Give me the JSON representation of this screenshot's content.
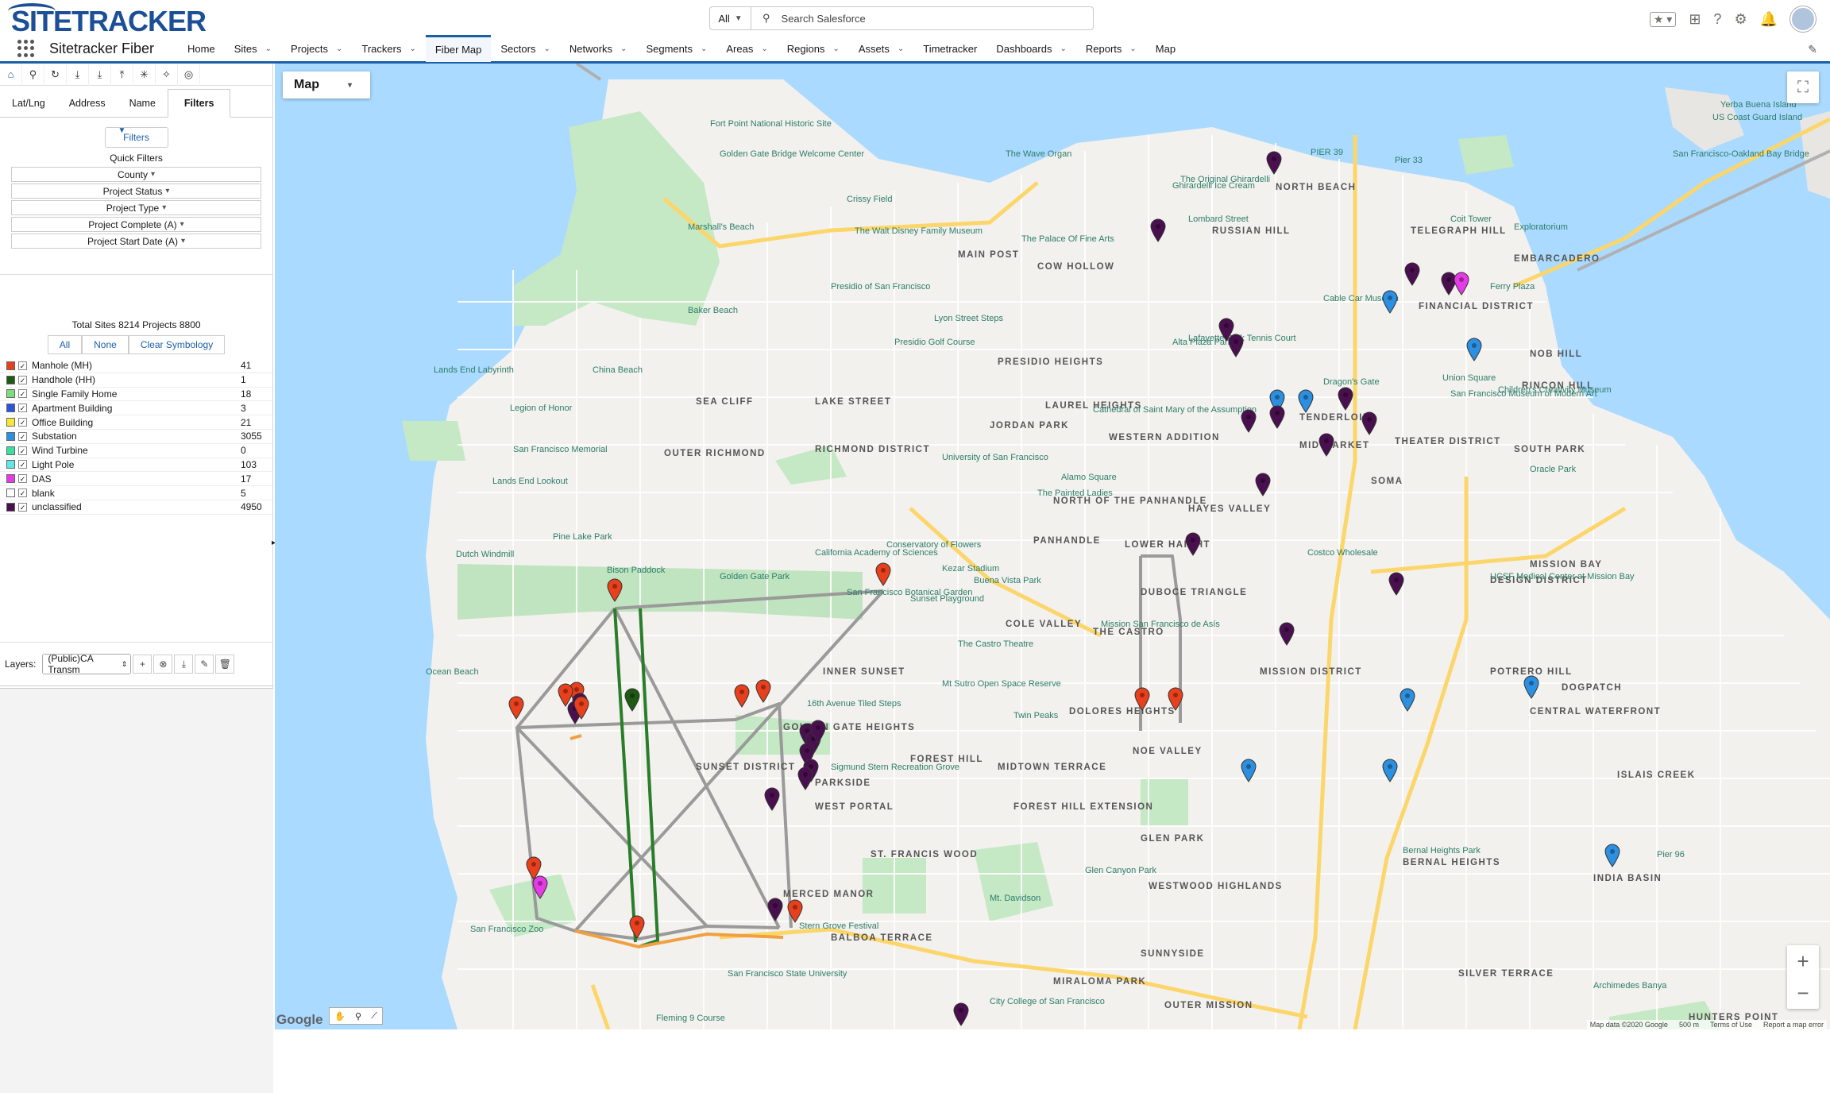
{
  "header": {
    "logo": "SITETRACKER",
    "search_scope": "All",
    "search_placeholder": "Search Salesforce"
  },
  "nav": {
    "app_name": "Sitetracker Fiber",
    "items": [
      {
        "label": "Home",
        "dropdown": false
      },
      {
        "label": "Sites",
        "dropdown": true
      },
      {
        "label": "Projects",
        "dropdown": true
      },
      {
        "label": "Trackers",
        "dropdown": true
      },
      {
        "label": "Fiber Map",
        "dropdown": false,
        "active": true
      },
      {
        "label": "Sectors",
        "dropdown": true
      },
      {
        "label": "Networks",
        "dropdown": true
      },
      {
        "label": "Segments",
        "dropdown": true
      },
      {
        "label": "Areas",
        "dropdown": true
      },
      {
        "label": "Regions",
        "dropdown": true
      },
      {
        "label": "Assets",
        "dropdown": true
      },
      {
        "label": "Timetracker",
        "dropdown": false
      },
      {
        "label": "Dashboards",
        "dropdown": true
      },
      {
        "label": "Reports",
        "dropdown": true
      },
      {
        "label": "Map",
        "dropdown": false
      }
    ]
  },
  "panel": {
    "tabs": [
      "Lat/Lng",
      "Address",
      "Name",
      "Filters"
    ],
    "active_tab": "Filters",
    "filters_button": "Filters",
    "quick_filters_label": "Quick Filters",
    "quick_filters": [
      "County",
      "Project Status",
      "Project Type",
      "Project Complete (A)",
      "Project Start Date (A)"
    ],
    "totals": "Total Sites 8214 Projects 8800",
    "symbology_buttons": [
      "All",
      "None",
      "Clear Symbology"
    ],
    "legend": [
      {
        "name": "Manhole (MH)",
        "count": "41",
        "color": "#e8401c"
      },
      {
        "name": "Handhole (HH)",
        "count": "1",
        "color": "#1e5a14"
      },
      {
        "name": "Single Family Home",
        "count": "18",
        "color": "#7be07b"
      },
      {
        "name": "Apartment Building",
        "count": "3",
        "color": "#2a55d8"
      },
      {
        "name": "Office Building",
        "count": "21",
        "color": "#f7e836"
      },
      {
        "name": "Substation",
        "count": "3055",
        "color": "#2c8fe0"
      },
      {
        "name": "Wind Turbine",
        "count": "0",
        "color": "#3be0a0"
      },
      {
        "name": "Light Pole",
        "count": "103",
        "color": "#5fe6e6"
      },
      {
        "name": "DAS",
        "count": "17",
        "color": "#e63ae6"
      },
      {
        "name": "blank",
        "count": "5",
        "color": "#ffffff"
      },
      {
        "name": "unclassified",
        "count": "4950",
        "color": "#4a0f4f"
      }
    ],
    "layers_label": "Layers:",
    "layer_select": "(Public)CA Transm"
  },
  "map": {
    "type_label": "Map",
    "attribution": "Map data ©2020 Google",
    "scale": "500 m",
    "terms": "Terms of Use",
    "report": "Report a map error",
    "google": "Google",
    "labels": [
      "NORTH BEACH",
      "TELEGRAPH HILL",
      "RUSSIAN HILL",
      "EMBARCADERO",
      "FINANCIAL DISTRICT",
      "COW HOLLOW",
      "MAIN POST",
      "PRESIDIO HEIGHTS",
      "LAUREL HEIGHTS",
      "JORDAN PARK",
      "LAKE STREET",
      "SEA CLIFF",
      "OUTER RICHMOND",
      "RICHMOND DISTRICT",
      "WESTERN ADDITION",
      "HAYES VALLEY",
      "NORTH OF THE PANHANDLE",
      "PANHANDLE",
      "LOWER HAIGHT",
      "TENDERLOIN",
      "THEATER DISTRICT",
      "SOMA",
      "MID MARKET",
      "SOUTH PARK",
      "NOB HILL",
      "RINCON HILL",
      "MISSION BAY",
      "DESIGN DISTRICT",
      "COLE VALLEY",
      "INNER SUNSET",
      "DUBOCE TRIANGLE",
      "THE CASTRO",
      "MISSION DISTRICT",
      "POTRERO HILL",
      "DOGPATCH",
      "CENTRAL WATERFRONT",
      "GOLDEN GATE HEIGHTS",
      "SUNSET DISTRICT",
      "DOLORES HEIGHTS",
      "NOE VALLEY",
      "FOREST HILL",
      "MIDTOWN TERRACE",
      "FOREST HILL EXTENSION",
      "WEST PORTAL",
      "PARKSIDE",
      "ISLAIS CREEK",
      "GLEN PARK",
      "ST. FRANCIS WOOD",
      "WESTWOOD HIGHLANDS",
      "MERCED MANOR",
      "BALBOA TERRACE",
      "SUNNYSIDE",
      "SILVER TERRACE",
      "INDIA BASIN",
      "MIRALOMA PARK",
      "OUTER MISSION",
      "HUNTERS POINT",
      "BERNAL HEIGHTS"
    ],
    "places": [
      "Fort Point National Historic Site",
      "Golden Gate Bridge Welcome Center",
      "Crissy Field",
      "The Wave Organ",
      "Marshall's Beach",
      "The Walt Disney Family Museum",
      "The Palace Of Fine Arts",
      "Presidio of San Francisco",
      "Baker Beach",
      "Presidio Golf Course",
      "Lyon Street Steps",
      "Lands End Labyrinth",
      "China Beach",
      "Legion of Honor",
      "San Francisco Memorial",
      "Lands End Lookout",
      "Lombard Street",
      "Coit Tower",
      "Exploratorium",
      "Pier 33",
      "PIER 39",
      "Ghirardelli Ice Cream",
      "The Original Ghirardelli",
      "Cable Car Museum",
      "Ferry Plaza",
      "Lafayette Park Tennis Court",
      "Alta Plaza Park",
      "Dragon's Gate",
      "Union Square",
      "San Francisco Museum of Modern Art",
      "Children's Creativity Museum",
      "Oracle Park",
      "Cathedral of Saint Mary of the Assumption",
      "University of San Francisco",
      "The Painted Ladies",
      "Alamo Square",
      "Dutch Windmill",
      "Bison Paddock",
      "Golden Gate Park",
      "California Academy of Sciences",
      "Conservatory of Flowers",
      "San Francisco Botanical Garden",
      "Kezar Stadium",
      "Buena Vista Park",
      "Costco Wholesale",
      "UCSF Medical Center at Mission Bay",
      "The Castro Theatre",
      "Mission San Francisco de Asís",
      "Ocean Beach",
      "Mt Sutro Open Space Reserve",
      "16th Avenue Tiled Steps",
      "Twin Peaks",
      "Stern Grove Festival",
      "Mt. Davidson",
      "Glen Canyon Park",
      "San Francisco Zoo",
      "Bernal Heights Park",
      "Pier 96",
      "Archimedes Banya",
      "San Francisco State University",
      "City College of San Francisco",
      "Fleming 9 Course",
      "US Coast Guard Island",
      "Yerba Buena Island",
      "San Francisco-Oakland Bay Bridge",
      "Sunset Playground",
      "Pine Lake Park",
      "Sigmund Stern Recreation Grove"
    ]
  },
  "colors": {
    "water": "#aadaff",
    "land": "#f2f1ee",
    "park": "#c5e8c5",
    "highway": "#fcd66b",
    "route_gray": "#9a9a9a",
    "route_green": "#2a7d2a",
    "route_orange": "#f0a040",
    "brand": "#1b5fa8"
  },
  "icons": [
    "home-icon",
    "pin-icon",
    "refresh-icon",
    "download-icon",
    "upload-icon",
    "settings-icon",
    "magic-icon",
    "target-icon",
    "filter-icon",
    "plus-icon",
    "close-icon",
    "pencil-icon",
    "trash-icon",
    "fullscreen-icon"
  ]
}
